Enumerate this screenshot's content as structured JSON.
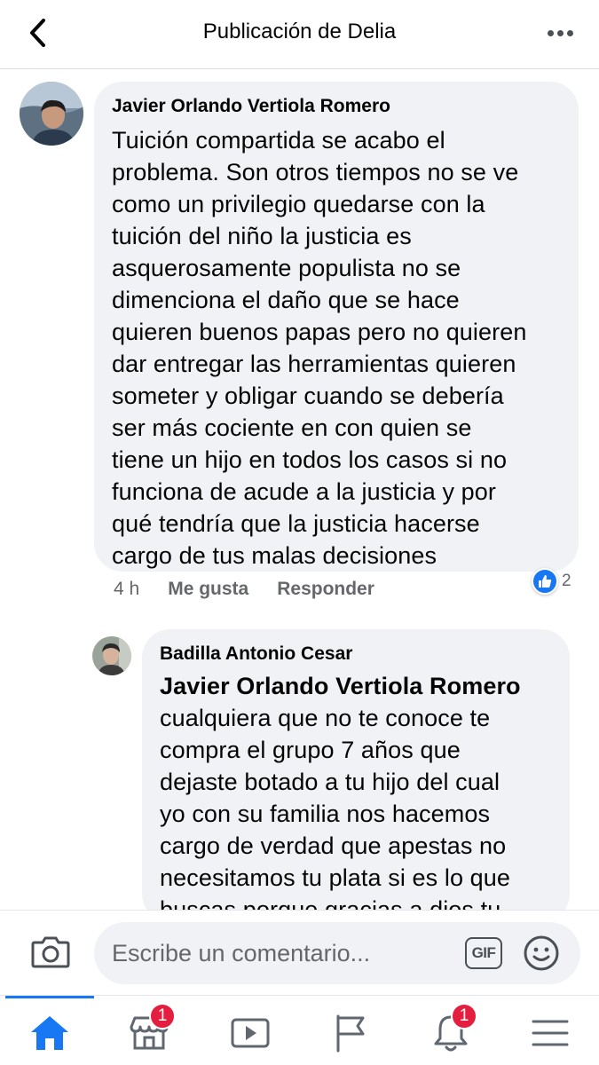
{
  "header": {
    "title": "Publicación de Delia",
    "back_icon": "chevron-left-icon",
    "more_icon": "more-horizontal-icon"
  },
  "comments": [
    {
      "author": "Javier Orlando Vertiola Romero",
      "lines": [
        "Tuición compartida se acabo el",
        "problema. Son otros tiempos no se ve",
        "como un privilegio  quedarse con la",
        "tuición del niño la justicia es",
        "asquerosamente  populista  no se",
        "dimenciona el daño que se hace",
        "quieren buenos papas pero no quieren",
        "dar entregar las herramientas quieren",
        "someter y obligar  cuando se debería",
        "ser más cociente en con quien se",
        "tiene un hijo  en todos los casos si no",
        "funciona  de acude a la justicia  y por",
        "qué tendría que la justicia hacerse",
        "cargo de tus malas decisiones"
      ],
      "time": "4 h",
      "like_label": "Me gusta",
      "reply_label": "Responder",
      "reaction_count": "2"
    }
  ],
  "reply": {
    "author": "Badilla Antonio Cesar",
    "mention": "Javier Orlando Vertiola Romero",
    "lines": [
      "cualquiera que no te conoce te",
      "compra el grupo 7 años que",
      "dejaste botado a tu hijo del cual",
      "yo con su familia nos hacemos",
      "cargo de verdad que apestas no",
      "necesitamos tu plata si es lo que",
      "buscas porque gracias a dios tu"
    ]
  },
  "composer": {
    "placeholder": "Escribe un comentario...",
    "gif_label": "GIF"
  },
  "tabbar": {
    "notification_badge_marketplace": "1",
    "notification_badge_bell": "1"
  },
  "colors": {
    "accent": "#1877f2",
    "bubble": "#f0f2f5",
    "secondary_text": "#65676b",
    "badge": "#e41e3f"
  }
}
